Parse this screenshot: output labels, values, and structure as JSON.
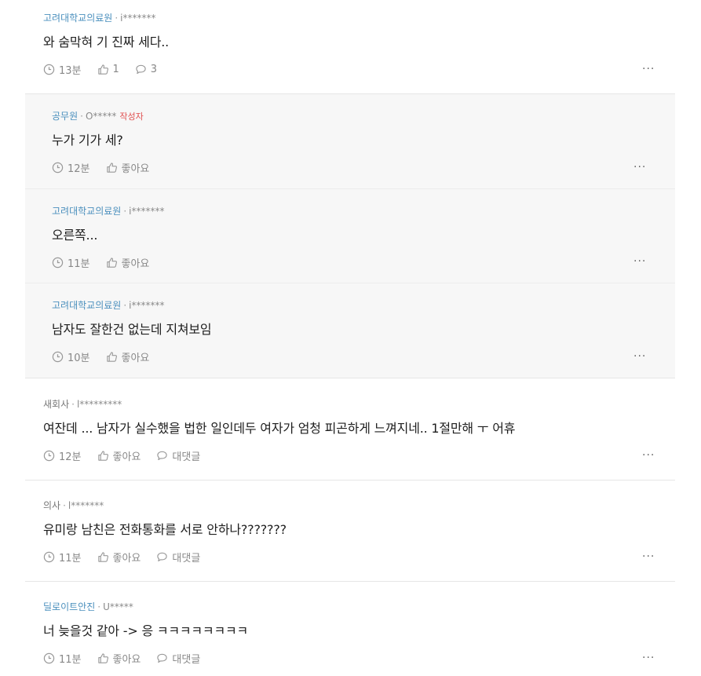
{
  "comments": [
    {
      "author": "고려대학교의료원",
      "user": "i*******",
      "text": "와 숨막혀 기 진짜 세다..",
      "time": "13분",
      "likes": "1",
      "replies": "3"
    },
    {
      "author": "공무원",
      "user": "O*****",
      "badge": "작성자",
      "text": "누가 기가 세?",
      "time": "12분",
      "like_label": "좋아요"
    },
    {
      "author": "고려대학교의료원",
      "user": "i*******",
      "text": "오른쪽...",
      "time": "11분",
      "like_label": "좋아요"
    },
    {
      "author": "고려대학교의료원",
      "user": "i*******",
      "text": "남자도 잘한건 없는데 지쳐보임",
      "time": "10분",
      "like_label": "좋아요"
    },
    {
      "author": "새회사",
      "user": "l*********",
      "text": "여잔데 ... 남자가 실수했을 법한 일인데두 여자가 엄청 피곤하게 느껴지네.. 1절만해 ㅜ 어휴",
      "time": "12분",
      "like_label": "좋아요",
      "reply_label": "대댓글"
    },
    {
      "author": "의사",
      "user": "l*******",
      "text": "유미랑 남친은 전화통화를 서로 안하나???????",
      "time": "11분",
      "like_label": "좋아요",
      "reply_label": "대댓글"
    },
    {
      "author": "딜로이트안진",
      "user": "U*****",
      "text": "너 늦을것 같아 -> 응 ㅋㅋㅋㅋㅋㅋㅋㅋ",
      "time": "11분",
      "like_label": "좋아요",
      "reply_label": "대댓글"
    }
  ],
  "separator": "·",
  "more_label": "···",
  "icons": {
    "clock": "clock-icon",
    "like": "thumbs-up-icon",
    "comment": "speech-bubble-icon",
    "more": "more-dots-icon"
  },
  "colors": {
    "author_link": "#4a8fbd",
    "author_badge": "#e05050",
    "reply_background": "#f7f7f7",
    "muted_text": "#888888"
  }
}
